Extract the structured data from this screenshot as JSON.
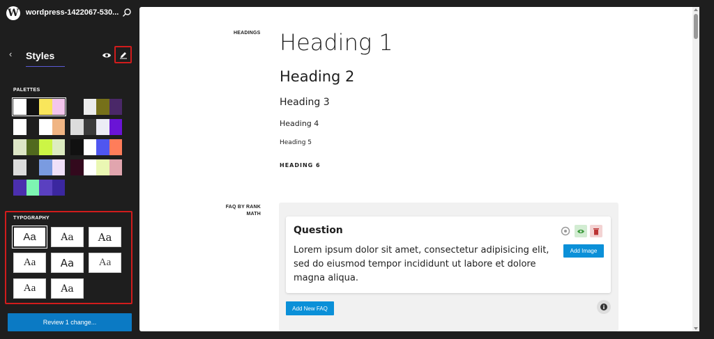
{
  "header": {
    "site_title": "wordpress-1422067-530..."
  },
  "styles_panel": {
    "title": "Styles",
    "palettes_label": "PALETTES",
    "palettes": [
      [
        "#ffffff",
        "#111111",
        "#f9e65b",
        "#f3c5ec"
      ],
      [
        "#1e1e1e",
        "#ececec",
        "#76701a",
        "#4a2868"
      ],
      [
        "#ffffff",
        "#1e1e1e",
        "#ffffff",
        "#f0b584"
      ],
      [
        "#dcdcdc",
        "#3c3c3c",
        "#ececf6",
        "#6a14d6"
      ],
      [
        "#dde6c6",
        "#51691e",
        "#ccf545",
        "#ddecc1"
      ],
      [
        "#111111",
        "#ffffff",
        "#4f56f0",
        "#ff7d5a"
      ],
      [
        "#dcdcdc",
        "#1e1e1e",
        "#7a9be0",
        "#efe0f8"
      ],
      [
        "#33091d",
        "#ffffff",
        "#eaf7b3",
        "#e1a5ae"
      ],
      [
        "#4b2fae",
        "#7df5b2",
        "#5a40c0",
        "#3b27a0"
      ]
    ],
    "typography_label": "TYPOGRAPHY",
    "font_sample": "Aa",
    "review_button": "Review 1 change..."
  },
  "canvas": {
    "headings_label": "HEADINGS",
    "headings": [
      "Heading 1",
      "Heading 2",
      "Heading 3",
      "Heading 4",
      "Heading 5",
      "HEADING 6"
    ],
    "faq_label": "FAQ BY RANK MATH",
    "faq": {
      "question": "Question",
      "answer": "Lorem ipsum dolor sit amet, consectetur adipisicing elit, sed do eiusmod tempor incididunt ut labore et dolore magna aliqua.",
      "add_image": "Add Image",
      "add_new_faq": "Add New FAQ"
    }
  },
  "colors": {
    "accent": "#0b7ac4",
    "highlight": "#d11c1c",
    "dark": "#1e1e1e"
  }
}
